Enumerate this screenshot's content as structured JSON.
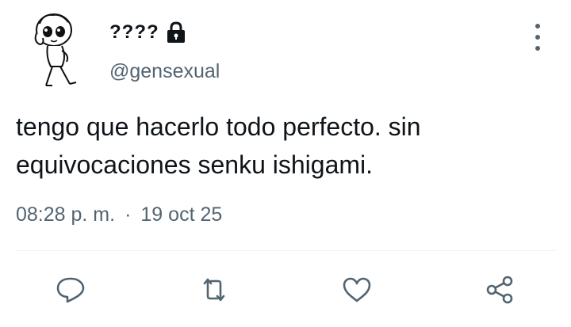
{
  "author": {
    "display_name": "????",
    "handle": "@gensexual",
    "avatar": "chibi-character-drawing",
    "protected_icon": "lock-icon"
  },
  "tweet": {
    "text_line1": "tengo que hacerlo todo perfecto. sin",
    "text_line2": "equivocaciones senku ishigami.",
    "time": "08:28 p. m.",
    "separator": "·",
    "date": "19 oct 25"
  },
  "actions": {
    "reply_icon": "reply-icon",
    "retweet_icon": "retweet-icon",
    "like_icon": "heart-icon",
    "share_icon": "share-icon"
  },
  "more_icon": "more-vertical-icon",
  "colors": {
    "text": "#0f1419",
    "secondary": "#536471",
    "divider": "#eff3f4"
  }
}
